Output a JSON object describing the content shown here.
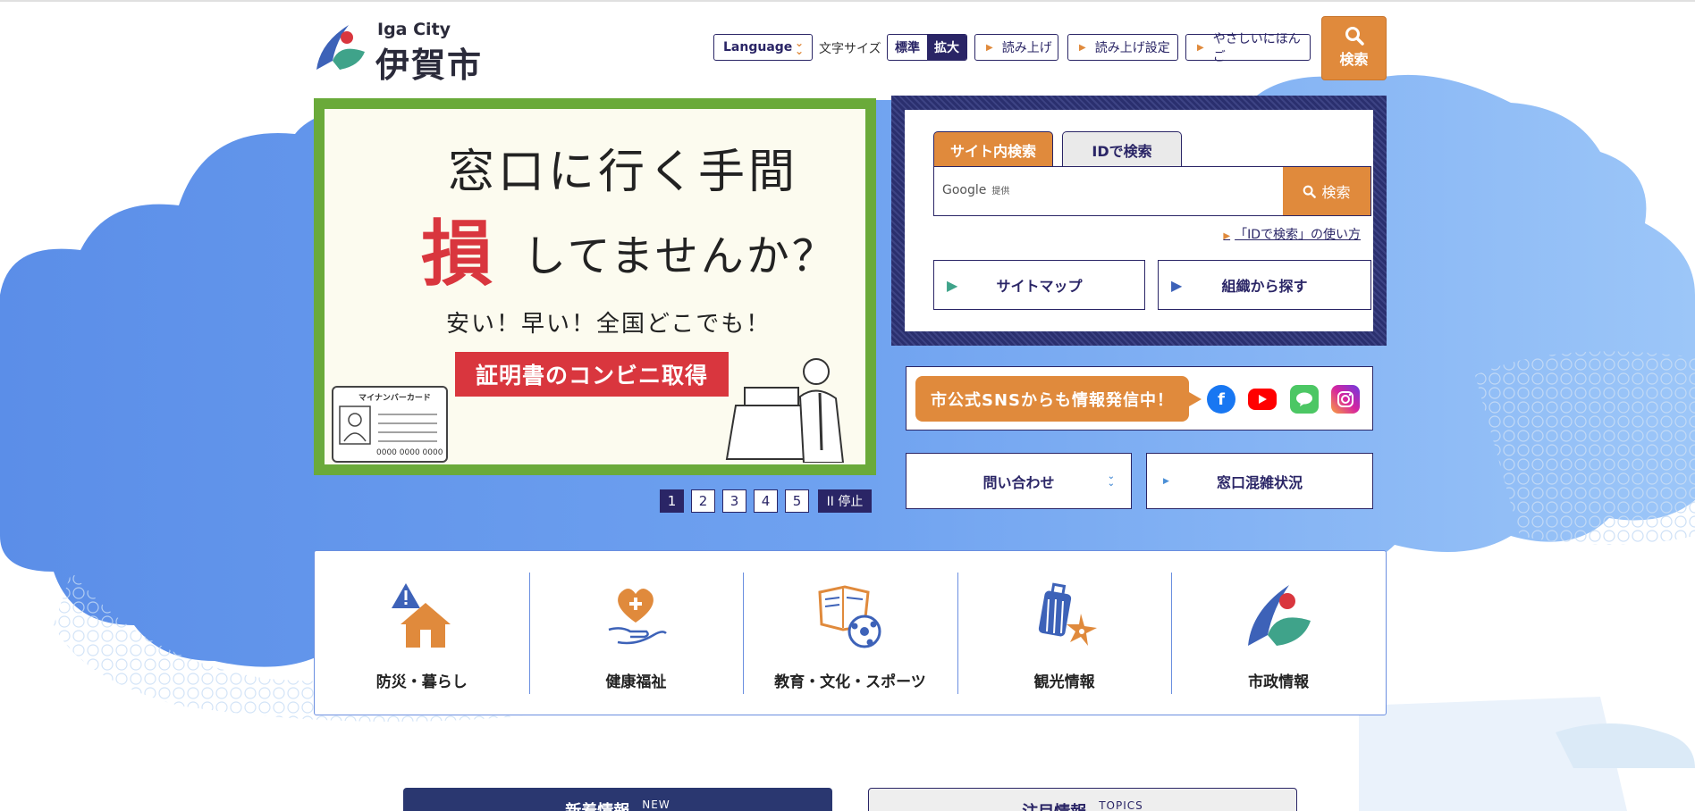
{
  "header": {
    "logo_en": "Iga City",
    "logo_jp": "伊賀市",
    "language_label": "Language",
    "font_size_label": "文字サイズ",
    "font_size_options": [
      "標準",
      "拡大"
    ],
    "read_aloud_label": "読み上げ",
    "read_aloud_settings_label": "読み上げ設定",
    "easy_japanese_label": "やさしいにほんご",
    "search_label": "検索"
  },
  "slider": {
    "line1": "窓口に行く手間",
    "line2_accent": "損",
    "line2_rest": "してませんか？",
    "line3": "安い！早い！全国どこでも！",
    "banner": "証明書のコンビニ取得",
    "card_title": "マイナンバーカード",
    "card_number": "0000 0000 0000",
    "pages": [
      "1",
      "2",
      "3",
      "4",
      "5"
    ],
    "current_page": "1",
    "pause_label": "II 停止"
  },
  "search_panel": {
    "tab_site": "サイト内検索",
    "tab_id": "IDで検索",
    "google_label": "Google",
    "google_sub": "提供",
    "search_button": "検索",
    "id_howto_link": "「IDで検索」の使い方",
    "sitemap_label": "サイトマップ",
    "org_label": "組織から探す"
  },
  "sns": {
    "message": "市公式SNSからも情報発信中！",
    "icons": [
      "facebook-icon",
      "youtube-icon",
      "line-icon",
      "instagram-icon"
    ]
  },
  "quick_links": {
    "contact_label": "問い合わせ",
    "congestion_label": "窓口混雑状況"
  },
  "categories": [
    {
      "label": "防災・暮らし",
      "icon": "disaster-home-icon"
    },
    {
      "label": "健康福祉",
      "icon": "health-heart-icon"
    },
    {
      "label": "教育・文化・スポーツ",
      "icon": "education-book-ball-icon"
    },
    {
      "label": "観光情報",
      "icon": "tourism-suitcase-icon"
    },
    {
      "label": "市政情報",
      "icon": "city-logo-icon"
    }
  ],
  "bottom_tabs": {
    "new_label": "新着情報",
    "new_en": "NEW",
    "topics_label": "注目情報",
    "topics_en": "TOPICS"
  },
  "colors": {
    "accent_orange": "#e08a3c",
    "navy": "#2a2566",
    "cloud_blue": "#6b9ef0",
    "slider_frame": "#6aaa3a",
    "banner_red": "#d9363e"
  }
}
